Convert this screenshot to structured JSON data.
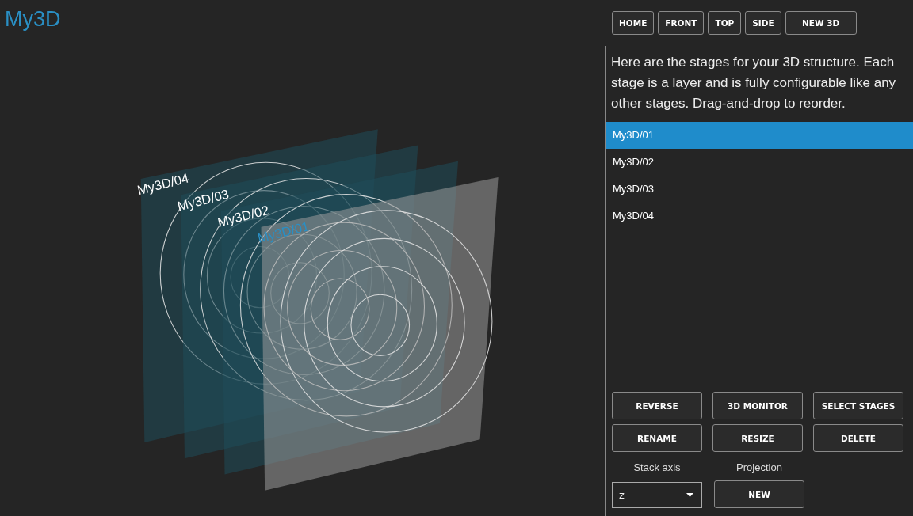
{
  "app": {
    "title": "My3D"
  },
  "view_buttons": [
    "HOME",
    "FRONT",
    "TOP",
    "SIDE",
    "NEW 3D"
  ],
  "scene": {
    "planes": [
      {
        "label": "My3D/04",
        "selected": false
      },
      {
        "label": "My3D/03",
        "selected": false
      },
      {
        "label": "My3D/02",
        "selected": false
      },
      {
        "label": "My3D/01",
        "selected": true
      }
    ]
  },
  "description": "Here are the stages for your 3D structure. Each stage is a layer and is fully configurable like any other stages. Drag-and-drop to reorder.",
  "stages": [
    {
      "label": "My3D/01",
      "selected": true
    },
    {
      "label": "My3D/02",
      "selected": false
    },
    {
      "label": "My3D/03",
      "selected": false
    },
    {
      "label": "My3D/04",
      "selected": false
    }
  ],
  "actions": [
    "REVERSE",
    "3D MONITOR",
    "SELECT STAGES",
    "RENAME",
    "RESIZE",
    "DELETE"
  ],
  "stack_axis": {
    "label": "Stack axis",
    "value": "z"
  },
  "projection": {
    "label": "Projection",
    "button": "NEW"
  }
}
